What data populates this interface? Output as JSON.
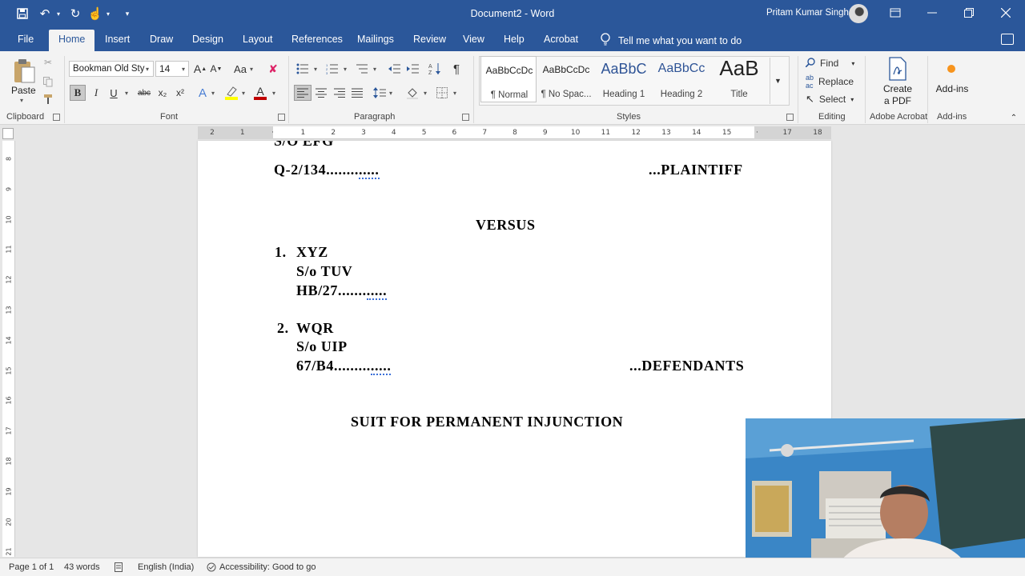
{
  "titlebar": {
    "document_title": "Document2  -  Word",
    "user_name": "Pritam Kumar Singh"
  },
  "tabs": [
    "File",
    "Home",
    "Insert",
    "Draw",
    "Design",
    "Layout",
    "References",
    "Mailings",
    "Review",
    "View",
    "Help",
    "Acrobat"
  ],
  "active_tab": "Home",
  "tell_me": "Tell me what you want to do",
  "ribbon": {
    "clipboard": {
      "paste_label": "Paste",
      "group_label": "Clipboard"
    },
    "font": {
      "font_name": "Bookman Old Sty",
      "font_size": "14",
      "group_label": "Font",
      "change_case": "Aa",
      "bold": "B",
      "italic": "I",
      "underline": "U",
      "strikethrough": "abc",
      "subscript": "x₂",
      "superscript": "x²",
      "font_color": "A",
      "text_effects": "A",
      "grow": "A",
      "shrink": "A"
    },
    "paragraph": {
      "group_label": "Paragraph",
      "pilcrow": "¶"
    },
    "styles": {
      "group_label": "Styles",
      "items": [
        {
          "sample": "AaBbCcDc",
          "name": "¶ Normal"
        },
        {
          "sample": "AaBbCcDc",
          "name": "¶ No Spac..."
        },
        {
          "sample": "AaBbC",
          "name": "Heading 1"
        },
        {
          "sample": "AaBbCc",
          "name": "Heading 2"
        },
        {
          "sample": "AaB",
          "name": "Title"
        }
      ]
    },
    "editing": {
      "find": "Find",
      "replace": "Replace",
      "select": "Select",
      "group_label": "Editing"
    },
    "acrobat": {
      "create_pdf_line1": "Create",
      "create_pdf_line2": "a PDF",
      "group_label": "Adobe Acrobat"
    },
    "addins": {
      "label": "Add-ins",
      "group_label": "Add-ins"
    }
  },
  "ruler_h": [
    "2",
    "1",
    "",
    "1",
    "2",
    "3",
    "4",
    "5",
    "6",
    "7",
    "8",
    "9",
    "10",
    "11",
    "12",
    "13",
    "14",
    "15",
    "",
    "17",
    "18"
  ],
  "ruler_v": [
    "8",
    "9",
    "10",
    "11",
    "12",
    "13",
    "14",
    "15",
    "16",
    "17",
    "18",
    "19",
    "20",
    "21"
  ],
  "document": {
    "cut_line": "S/O EFG",
    "plaintiff_address_main": "Q-2/134........",
    "plaintiff_address_dots": ".....",
    "plaintiff_role": "...PLAINTIFF",
    "versus": "VERSUS",
    "d1_number": "1.",
    "d1_name": "XYZ",
    "d1_relation": "S/o TUV",
    "d1_address_main": "HB/27.......",
    "d1_address_dots": ".....",
    "d2_number": "2.",
    "d2_name": "WQR",
    "d2_relation": "S/o UIP",
    "d2_address_main": "67/B4.........",
    "d2_address_dots": ".....",
    "defendants_role": "...DEFENDANTS",
    "suit_title": "SUIT FOR PERMANENT INJUNCTION"
  },
  "statusbar": {
    "page": "Page 1 of 1",
    "words": "43 words",
    "language": "English (India)",
    "accessibility": "Accessibility: Good to go"
  },
  "colors": {
    "word_blue": "#2b579a",
    "ribbon_bg": "#f3f3f3",
    "font_color_red": "#c00000",
    "highlight_yellow": "#ffff00",
    "spell_check_blue": "#3a6fd8"
  }
}
